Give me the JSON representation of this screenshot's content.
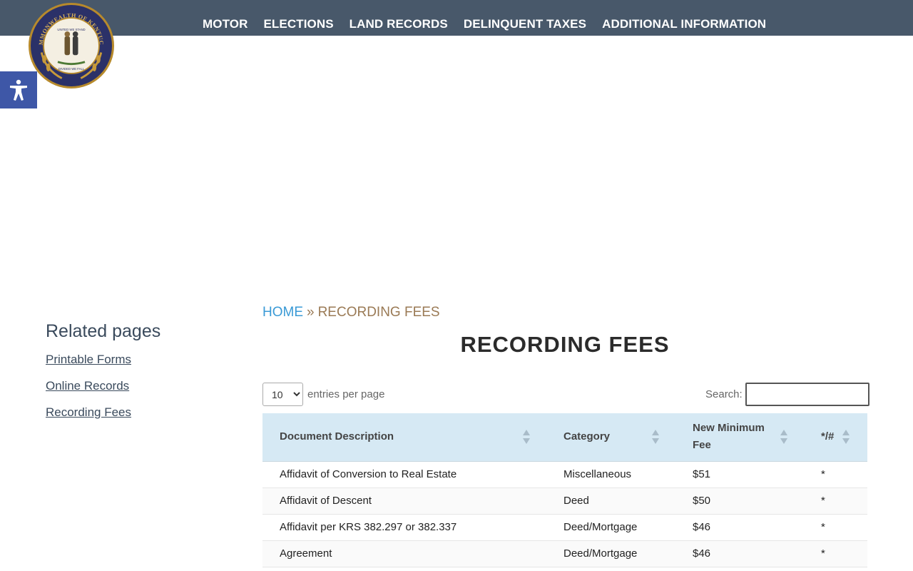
{
  "nav": {
    "items": [
      "MOTOR",
      "ELECTIONS",
      "LAND RECORDS",
      "DELINQUENT TAXES",
      "ADDITIONAL INFORMATION"
    ]
  },
  "seal": {
    "top_text": "COMMONWEALTH OF KENTUCKY",
    "banner_text": "UNITED WE STAND",
    "bottom_text": "DIVIDED WE FALL"
  },
  "colors": {
    "topbar": "#48586a",
    "link_blue": "#3a9ad6",
    "breadcrumb_current": "#9a7a55",
    "table_header": "#d6e9f4",
    "a11y_button": "#3e57a7"
  },
  "icons": {
    "accessibility": "accessibility-icon",
    "sort": "sort-arrows-icon"
  },
  "sidebar": {
    "heading": "Related pages",
    "links": [
      "Printable Forms",
      "Online Records",
      "Recording Fees"
    ]
  },
  "breadcrumb": {
    "home": "HOME",
    "separator": "»",
    "current": "RECORDING FEES"
  },
  "page_title": "RECORDING FEES",
  "table_controls": {
    "page_size": "10",
    "page_size_options": [
      "10"
    ],
    "entries_label": "entries per page",
    "search_label": "Search:",
    "search_value": ""
  },
  "table": {
    "columns": [
      "Document Description",
      "Category",
      "New Minimum Fee",
      "*/#"
    ],
    "rows": [
      [
        "Affidavit of Conversion to Real Estate",
        "Miscellaneous",
        "$51",
        "*"
      ],
      [
        "Affidavit of Descent",
        "Deed",
        "$50",
        "*"
      ],
      [
        "Affidavit per KRS 382.297 or 382.337",
        "Deed/Mortgage",
        "$46",
        "*"
      ],
      [
        "Agreement",
        "Deed/Mortgage",
        "$46",
        "*"
      ]
    ]
  }
}
